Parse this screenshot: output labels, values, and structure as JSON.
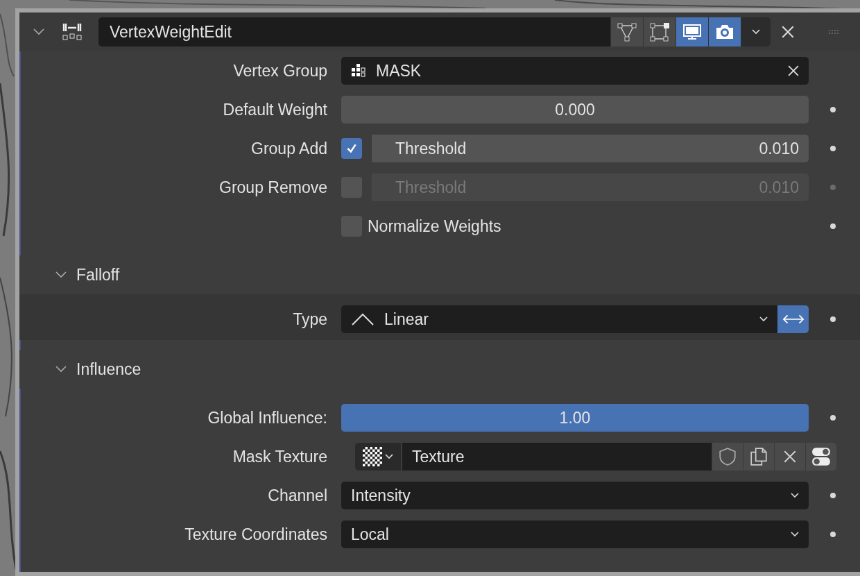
{
  "modifier": {
    "title": "VertexWeightEdit",
    "expanded": true,
    "toggles": [
      {
        "kind": "edit-mode",
        "on": false
      },
      {
        "kind": "cage",
        "on": false
      },
      {
        "kind": "viewport",
        "on": true
      },
      {
        "kind": "render",
        "on": true
      }
    ]
  },
  "rows": [
    {
      "kind": "group",
      "label": "Vertex Group",
      "value": "MASK"
    },
    {
      "kind": "number",
      "label": "Default Weight",
      "value": "0.000"
    },
    {
      "kind": "check-number",
      "label": "Group Add",
      "checked": true,
      "field_label": "Threshold",
      "value": "0.010"
    },
    {
      "kind": "check-number",
      "label": "Group Remove",
      "checked": false,
      "field_label": "Threshold",
      "value": "0.010"
    },
    {
      "kind": "check",
      "label": "Normalize Weights",
      "checked": false
    }
  ],
  "sections": [
    {
      "title": "Falloff",
      "expanded": true,
      "rows": [
        {
          "kind": "falloff",
          "label": "Type",
          "value": "Linear",
          "invert": true
        }
      ]
    },
    {
      "title": "Influence",
      "expanded": true,
      "rows": [
        {
          "kind": "slider",
          "label": "Global Influence:",
          "value": "1.00",
          "level": 1
        },
        {
          "kind": "texture",
          "label": "Mask Texture",
          "value": "Texture"
        },
        {
          "kind": "dropdown",
          "label": "Channel",
          "value": "Intensity"
        },
        {
          "kind": "dropdown",
          "label": "Texture Coordinates",
          "value": "Local"
        }
      ]
    }
  ]
}
